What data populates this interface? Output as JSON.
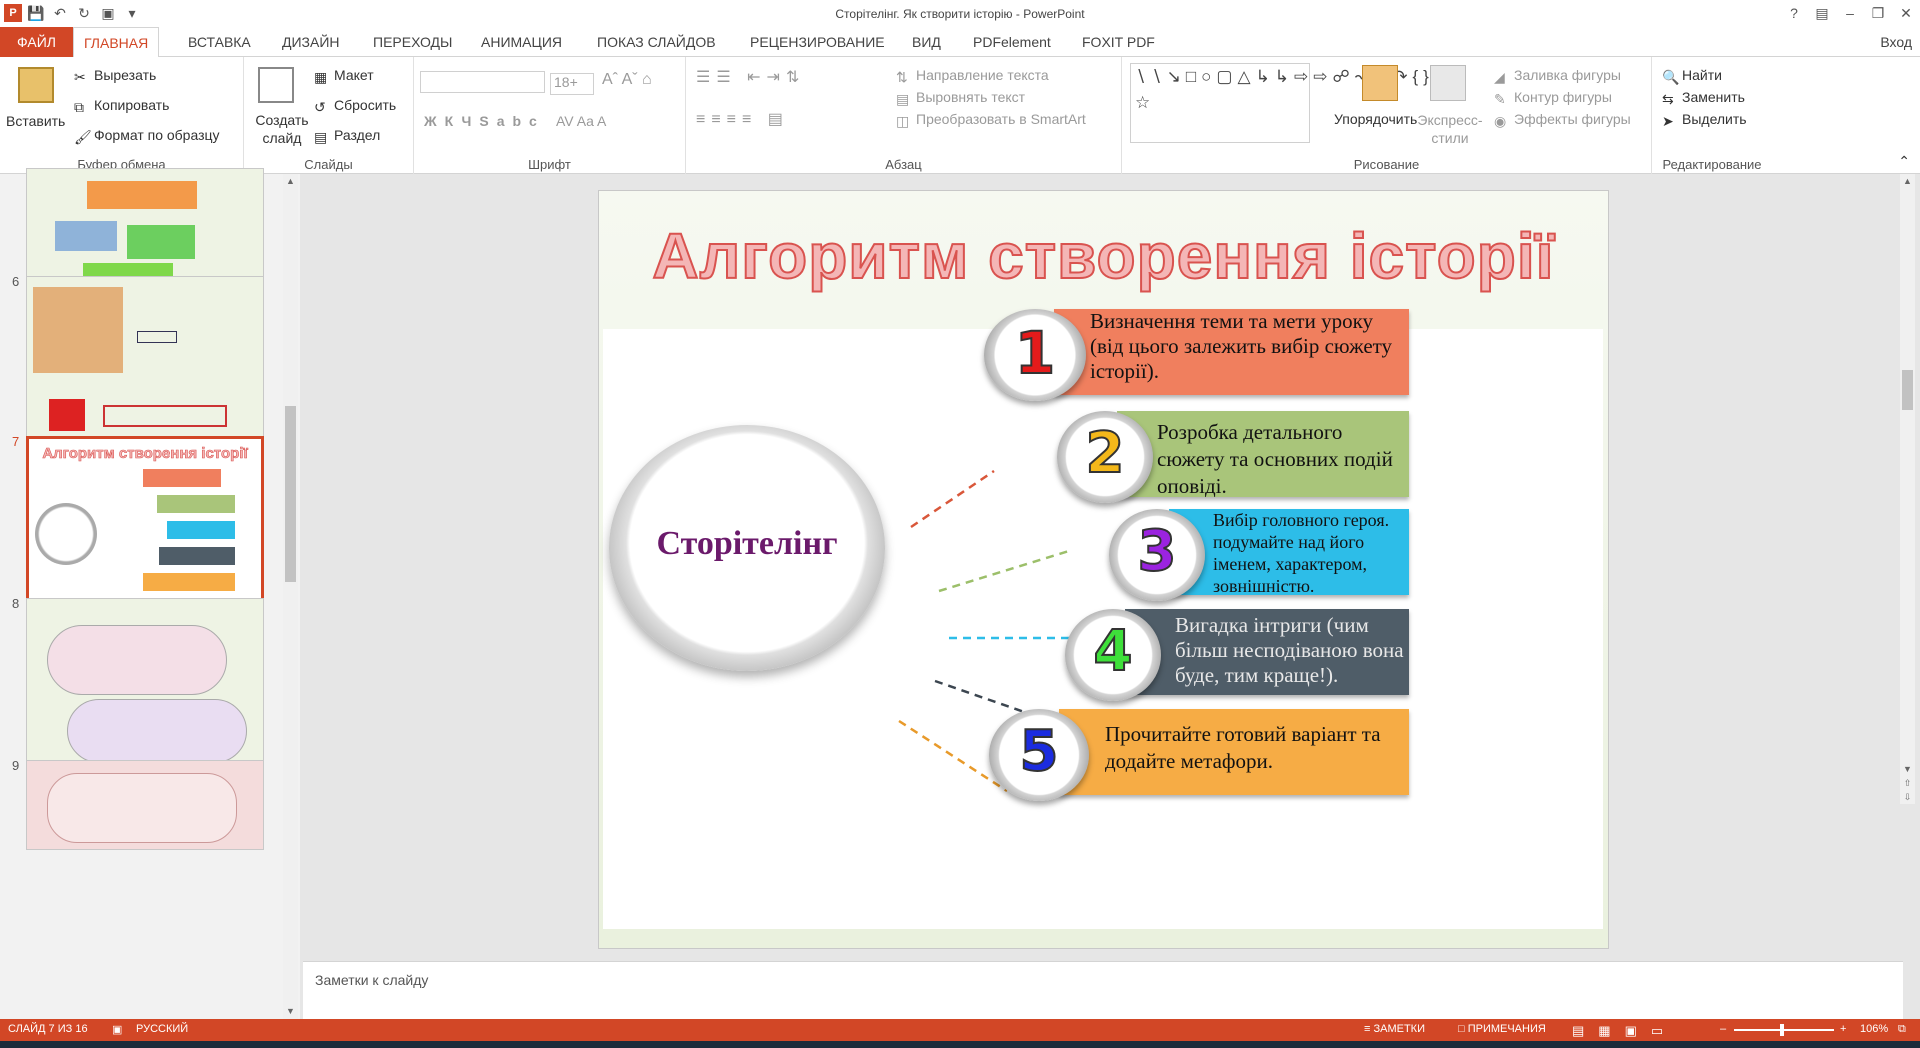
{
  "window": {
    "title": "Сторітелінг. Як створити історію - PowerPoint"
  },
  "tabs": [
    "ФАЙЛ",
    "ГЛАВНАЯ",
    "ВСТАВКА",
    "ДИЗАЙН",
    "ПЕРЕХОДЫ",
    "АНИМАЦИЯ",
    "ПОКАЗ СЛАЙДОВ",
    "РЕЦЕНЗИРОВАНИЕ",
    "ВИД",
    "PDFelement",
    "FOXIT PDF"
  ],
  "signin": "Вход",
  "ribbon": {
    "clipboard": {
      "paste": "Вставить",
      "cut": "Вырезать",
      "copy": "Копировать",
      "format": "Формат по образцу",
      "label": "Буфер обмена"
    },
    "slides": {
      "new": "Создать слайд",
      "layout": "Макет",
      "reset": "Сбросить",
      "section": "Раздел",
      "label": "Слайды"
    },
    "font": {
      "size": "18+",
      "label": "Шрифт"
    },
    "paragraph": {
      "dir": "Направление текста",
      "align": "Выровнять текст",
      "smartart": "Преобразовать в SmartArt",
      "label": "Абзац"
    },
    "drawing": {
      "arrange": "Упорядочить",
      "styles": "Экспресс-стили",
      "fill": "Заливка фигуры",
      "outline": "Контур фигуры",
      "effects": "Эффекты фигуры",
      "label": "Рисование"
    },
    "editing": {
      "find": "Найти",
      "replace": "Заменить",
      "select": "Выделить",
      "label": "Редактирование"
    }
  },
  "thumbnails": {
    "numbers": [
      "6",
      "7",
      "8",
      "9"
    ]
  },
  "slide": {
    "title": "Алгоритм створення історії",
    "hub": "Сторітелінг",
    "steps": [
      {
        "n": "1",
        "text": "Визначення теми та мети уроку (від цього залежить вибір сюжету історії).",
        "color": "#f07f5e"
      },
      {
        "n": "2",
        "text": "Розробка детального сюжету та основних подій оповіді.",
        "color": "#a9c57a"
      },
      {
        "n": "3",
        "text": "Вибір головного героя. подумайте над його іменем, характером, зовнішністю.",
        "color": "#2dbde8"
      },
      {
        "n": "4",
        "text": "Вигадка інтриги (чим більш несподіваною вона буде, тим краще!).",
        "color": "#4f5d68"
      },
      {
        "n": "5",
        "text": "Прочитайте готовий варіант та додайте метафори.",
        "color": "#f6ac45"
      }
    ]
  },
  "notes": "Заметки к слайду",
  "status": {
    "slide": "СЛАЙД 7 ИЗ 16",
    "lang": "РУССКИЙ",
    "notes": "ЗАМЕТКИ",
    "comments": "ПРИМЕЧАНИЯ",
    "zoom": "106%"
  }
}
